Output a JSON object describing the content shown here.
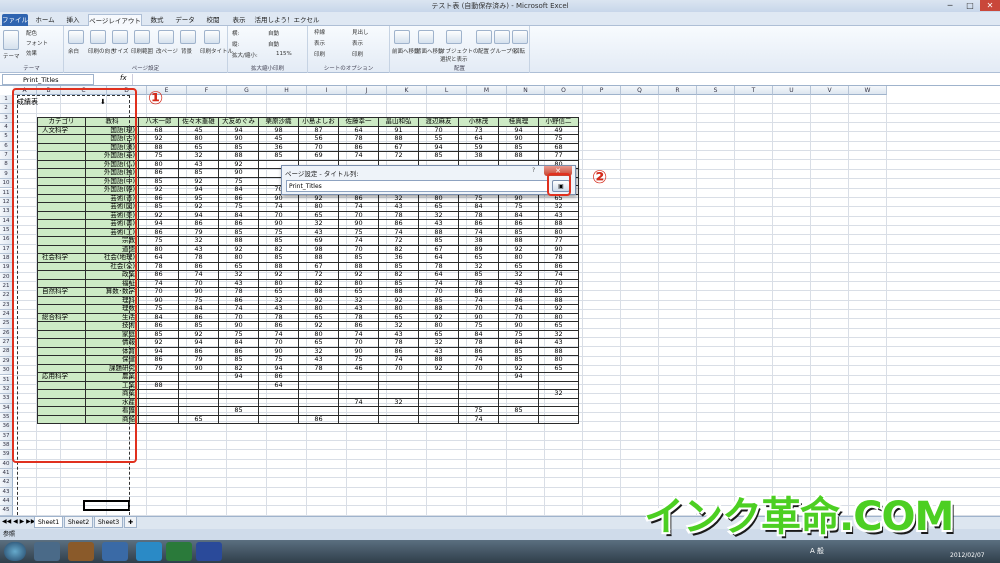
{
  "window": {
    "title": "テスト表 (自動保存済み) - Microsoft Excel",
    "min": "─",
    "max": "□",
    "close": "✕"
  },
  "tabs": [
    "ファイル",
    "ホーム",
    "挿入",
    "ページレイアウト",
    "数式",
    "データ",
    "校閲",
    "表示",
    "活用しよう！エクセル"
  ],
  "ribbon": {
    "theme": {
      "items": [
        "テーマ",
        "配色",
        "フォント",
        "効果"
      ],
      "label": "テーマ"
    },
    "page_setup": {
      "items": [
        "余白",
        "印刷の向き",
        "サイズ",
        "印刷範囲",
        "改ページ",
        "背景",
        "印刷タイトル"
      ],
      "label": "ページ設定"
    },
    "scale": {
      "items": [
        "横:",
        "縦:",
        "拡大/縮小:",
        "自動",
        "自動",
        "115%"
      ],
      "label": "拡大縮小印刷"
    },
    "sheet_opts": {
      "items": [
        "枠線",
        "見出し",
        "表示",
        "表示",
        "印刷",
        "印刷"
      ],
      "label": "シートのオプション"
    },
    "arrange": {
      "items": [
        "前面へ移動",
        "背面へ移動",
        "オブジェクトの選択と表示",
        "配置",
        "グループ化",
        "回転"
      ],
      "label": "配置"
    }
  },
  "formula_bar": {
    "name_box": "Print_Titles",
    "fx": "fx",
    "value": ""
  },
  "columns": [
    "A",
    "B",
    "C",
    "D",
    "E",
    "F",
    "G",
    "H",
    "I",
    "J",
    "K",
    "L",
    "M",
    "N",
    "O",
    "P",
    "Q",
    "R",
    "S",
    "T",
    "U",
    "V",
    "W"
  ],
  "rows": [
    "1",
    "2",
    "3",
    "4",
    "5",
    "6",
    "7",
    "8",
    "9",
    "10",
    "11",
    "12",
    "13",
    "14",
    "15",
    "16",
    "17",
    "18",
    "19",
    "20",
    "21",
    "22",
    "23",
    "24",
    "25",
    "26",
    "27",
    "28",
    "29",
    "30",
    "31",
    "32",
    "33",
    "34",
    "35",
    "36",
    "37",
    "38",
    "39",
    "40",
    "41",
    "42",
    "43",
    "44",
    "45"
  ],
  "sheet": {
    "title": "成績表",
    "headers": [
      "カテゴリ",
      "教科",
      "八木一郎",
      "佐々木重雄",
      "大友めぐみ",
      "栗原沙織",
      "小島よしお",
      "佐藤幸一",
      "畠山和弘",
      "渡辺麻友",
      "小林茂",
      "桂真理",
      "小野信二"
    ],
    "rows": [
      [
        "人文科学",
        "国語(現)",
        "68",
        "45",
        "94",
        "98",
        "87",
        "64",
        "91",
        "70",
        "73",
        "94",
        "49"
      ],
      [
        "",
        "国語(古)",
        "92",
        "80",
        "90",
        "45",
        "56",
        "78",
        "88",
        "55",
        "64",
        "90",
        "75"
      ],
      [
        "",
        "国語(漢)",
        "88",
        "65",
        "85",
        "36",
        "70",
        "86",
        "67",
        "94",
        "59",
        "85",
        "68"
      ],
      [
        "",
        "外国語(英)",
        "75",
        "32",
        "88",
        "85",
        "69",
        "74",
        "72",
        "85",
        "38",
        "88",
        "77"
      ],
      [
        "",
        "外国語(仏)",
        "80",
        "43",
        "92",
        "",
        "",
        "",
        "",
        "",
        "",
        "",
        "80"
      ],
      [
        "",
        "外国語(独)",
        "86",
        "85",
        "90",
        "",
        "",
        "",
        "",
        "",
        "",
        "",
        "73"
      ],
      [
        "",
        "外国語(中)",
        "85",
        "92",
        "75",
        "",
        "",
        "",
        "",
        "",
        "",
        "",
        "62"
      ],
      [
        "",
        "外国語(韓)",
        "92",
        "94",
        "84",
        "70",
        "65",
        "70",
        "78",
        "32",
        "78",
        "84",
        "43"
      ],
      [
        "",
        "芸術(音)",
        "86",
        "95",
        "86",
        "90",
        "92",
        "86",
        "32",
        "80",
        "75",
        "90",
        "65"
      ],
      [
        "",
        "芸術(図)",
        "85",
        "92",
        "75",
        "74",
        "80",
        "74",
        "43",
        "65",
        "84",
        "75",
        "32"
      ],
      [
        "",
        "芸術(美)",
        "92",
        "94",
        "84",
        "70",
        "65",
        "70",
        "78",
        "32",
        "78",
        "84",
        "43"
      ],
      [
        "",
        "芸術(書)",
        "94",
        "86",
        "86",
        "90",
        "32",
        "90",
        "86",
        "43",
        "86",
        "86",
        "88"
      ],
      [
        "",
        "芸術(工)",
        "86",
        "79",
        "85",
        "75",
        "43",
        "75",
        "74",
        "88",
        "74",
        "85",
        "80"
      ],
      [
        "",
        "宗教",
        "75",
        "32",
        "88",
        "85",
        "69",
        "74",
        "72",
        "85",
        "38",
        "88",
        "77"
      ],
      [
        "",
        "道徳",
        "80",
        "43",
        "92",
        "82",
        "98",
        "70",
        "82",
        "67",
        "89",
        "92",
        "90"
      ],
      [
        "社会科学",
        "社会(地理)",
        "64",
        "78",
        "80",
        "85",
        "88",
        "85",
        "36",
        "64",
        "65",
        "80",
        "78"
      ],
      [
        "",
        "社会(公)",
        "78",
        "86",
        "65",
        "88",
        "67",
        "88",
        "85",
        "78",
        "32",
        "65",
        "86"
      ],
      [
        "",
        "政業",
        "86",
        "74",
        "32",
        "92",
        "72",
        "92",
        "82",
        "64",
        "85",
        "32",
        "74"
      ],
      [
        "",
        "福祉",
        "74",
        "70",
        "43",
        "80",
        "82",
        "80",
        "85",
        "74",
        "78",
        "43",
        "70"
      ],
      [
        "自然科学",
        "算数･数学",
        "70",
        "90",
        "78",
        "65",
        "88",
        "65",
        "88",
        "70",
        "86",
        "78",
        "85"
      ],
      [
        "",
        "理科",
        "90",
        "75",
        "86",
        "32",
        "92",
        "32",
        "92",
        "85",
        "74",
        "86",
        "88"
      ],
      [
        "",
        "理数",
        "75",
        "84",
        "74",
        "43",
        "80",
        "43",
        "80",
        "88",
        "70",
        "74",
        "92"
      ],
      [
        "総合科学",
        "生活",
        "84",
        "86",
        "70",
        "78",
        "65",
        "78",
        "65",
        "92",
        "90",
        "70",
        "80"
      ],
      [
        "",
        "技術",
        "86",
        "85",
        "90",
        "86",
        "92",
        "86",
        "32",
        "80",
        "75",
        "90",
        "65"
      ],
      [
        "",
        "家庭",
        "85",
        "92",
        "75",
        "74",
        "80",
        "74",
        "43",
        "65",
        "84",
        "75",
        "32"
      ],
      [
        "",
        "情報",
        "92",
        "94",
        "84",
        "70",
        "65",
        "70",
        "78",
        "32",
        "78",
        "84",
        "43"
      ],
      [
        "",
        "体育",
        "94",
        "86",
        "86",
        "90",
        "32",
        "90",
        "86",
        "43",
        "86",
        "85",
        "88"
      ],
      [
        "",
        "保健",
        "86",
        "79",
        "85",
        "75",
        "43",
        "75",
        "74",
        "88",
        "74",
        "85",
        "80"
      ],
      [
        "",
        "課題研究",
        "79",
        "90",
        "82",
        "94",
        "78",
        "46",
        "70",
        "92",
        "70",
        "92",
        "65"
      ],
      [
        "応用科学",
        "農業",
        "",
        "",
        "94",
        "86",
        "",
        "",
        "",
        "",
        "",
        "94",
        ""
      ],
      [
        "",
        "工業",
        "88",
        "",
        "",
        "64",
        "",
        "",
        "",
        "",
        "",
        "",
        ""
      ],
      [
        "",
        "商業",
        "",
        "",
        "",
        "",
        "",
        "",
        "",
        "",
        "",
        "",
        "32"
      ],
      [
        "",
        "水産",
        "",
        "",
        "",
        "",
        "",
        "74",
        "32",
        "",
        "",
        "",
        ""
      ],
      [
        "",
        "看護",
        "",
        "",
        "85",
        "",
        "",
        "",
        "",
        "",
        "75",
        "85",
        ""
      ],
      [
        "",
        "商船",
        "",
        "65",
        "",
        "",
        "86",
        "",
        "",
        "",
        "74",
        "",
        ""
      ]
    ]
  },
  "dialog": {
    "title": "ページ設定 - タイトル列:",
    "value": "Print_Titles",
    "help": "?",
    "close": "✕",
    "collapse": "▣"
  },
  "sheet_tabs": [
    "Sheet1",
    "Sheet2",
    "Sheet3"
  ],
  "status": "参照",
  "callouts": [
    "①",
    "②"
  ],
  "watermark": "インク革命.COM",
  "clock": "2012/02/07",
  "tray": "A 般"
}
